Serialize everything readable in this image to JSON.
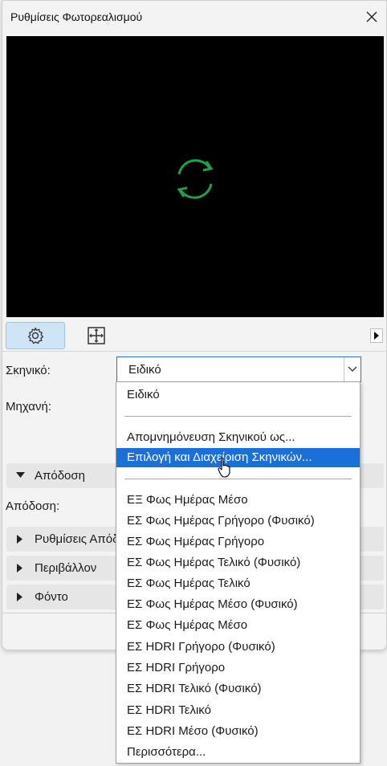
{
  "window": {
    "title": "Ρυθμίσεις Φωτορεαλισμού"
  },
  "icons": {
    "close": "close-icon",
    "loading": "refresh-spinner-icon",
    "settings": "gear-icon",
    "layout": "grid-move-icon",
    "expand": "triangle-right-icon"
  },
  "colors": {
    "accent": "#1b6fd8",
    "spinner": "#1fa04a",
    "preview_bg": "#000000"
  },
  "form": {
    "scene_label": "Σκηνικό:",
    "scene_value": "Ειδικό",
    "engine_label": "Μηχανή:",
    "render_label": "Απόδοση:"
  },
  "sections": [
    {
      "label": "Απόδοση",
      "expanded": true
    },
    {
      "label": "Ρυθμίσεις Απόδοσης",
      "expanded": false
    },
    {
      "label": "Περιβάλλον",
      "expanded": false
    },
    {
      "label": "Φόντο",
      "expanded": false
    }
  ],
  "dropdown": {
    "top_item": "Ειδικό",
    "save_item": "Απομνημόνευση Σκηνικού ως...",
    "manage_item": "Επιλογή και Διαχείριση Σκηνικών...",
    "presets": [
      "ΕΞ Φως Ημέρας Μέσο",
      "ΕΣ Φως Ημέρας Γρήγορο (Φυσικό)",
      "ΕΣ Φως Ημέρας Γρήγορο",
      "ΕΣ Φως Ημέρας Τελικό (Φυσικό)",
      "ΕΣ Φως Ημέρας Τελικό",
      "ΕΣ Φως Ημέρας Μέσο (Φυσικό)",
      "ΕΣ Φως Ημέρας Μέσο",
      "ΕΣ HDRI Γρήγορο (Φυσικό)",
      "ΕΣ HDRI Γρήγορο",
      "ΕΣ HDRI Τελικό (Φυσικό)",
      "ΕΣ HDRI Τελικό",
      "ΕΣ HDRI Μέσο (Φυσικό)"
    ],
    "more_item": "Περισσότερα..."
  }
}
